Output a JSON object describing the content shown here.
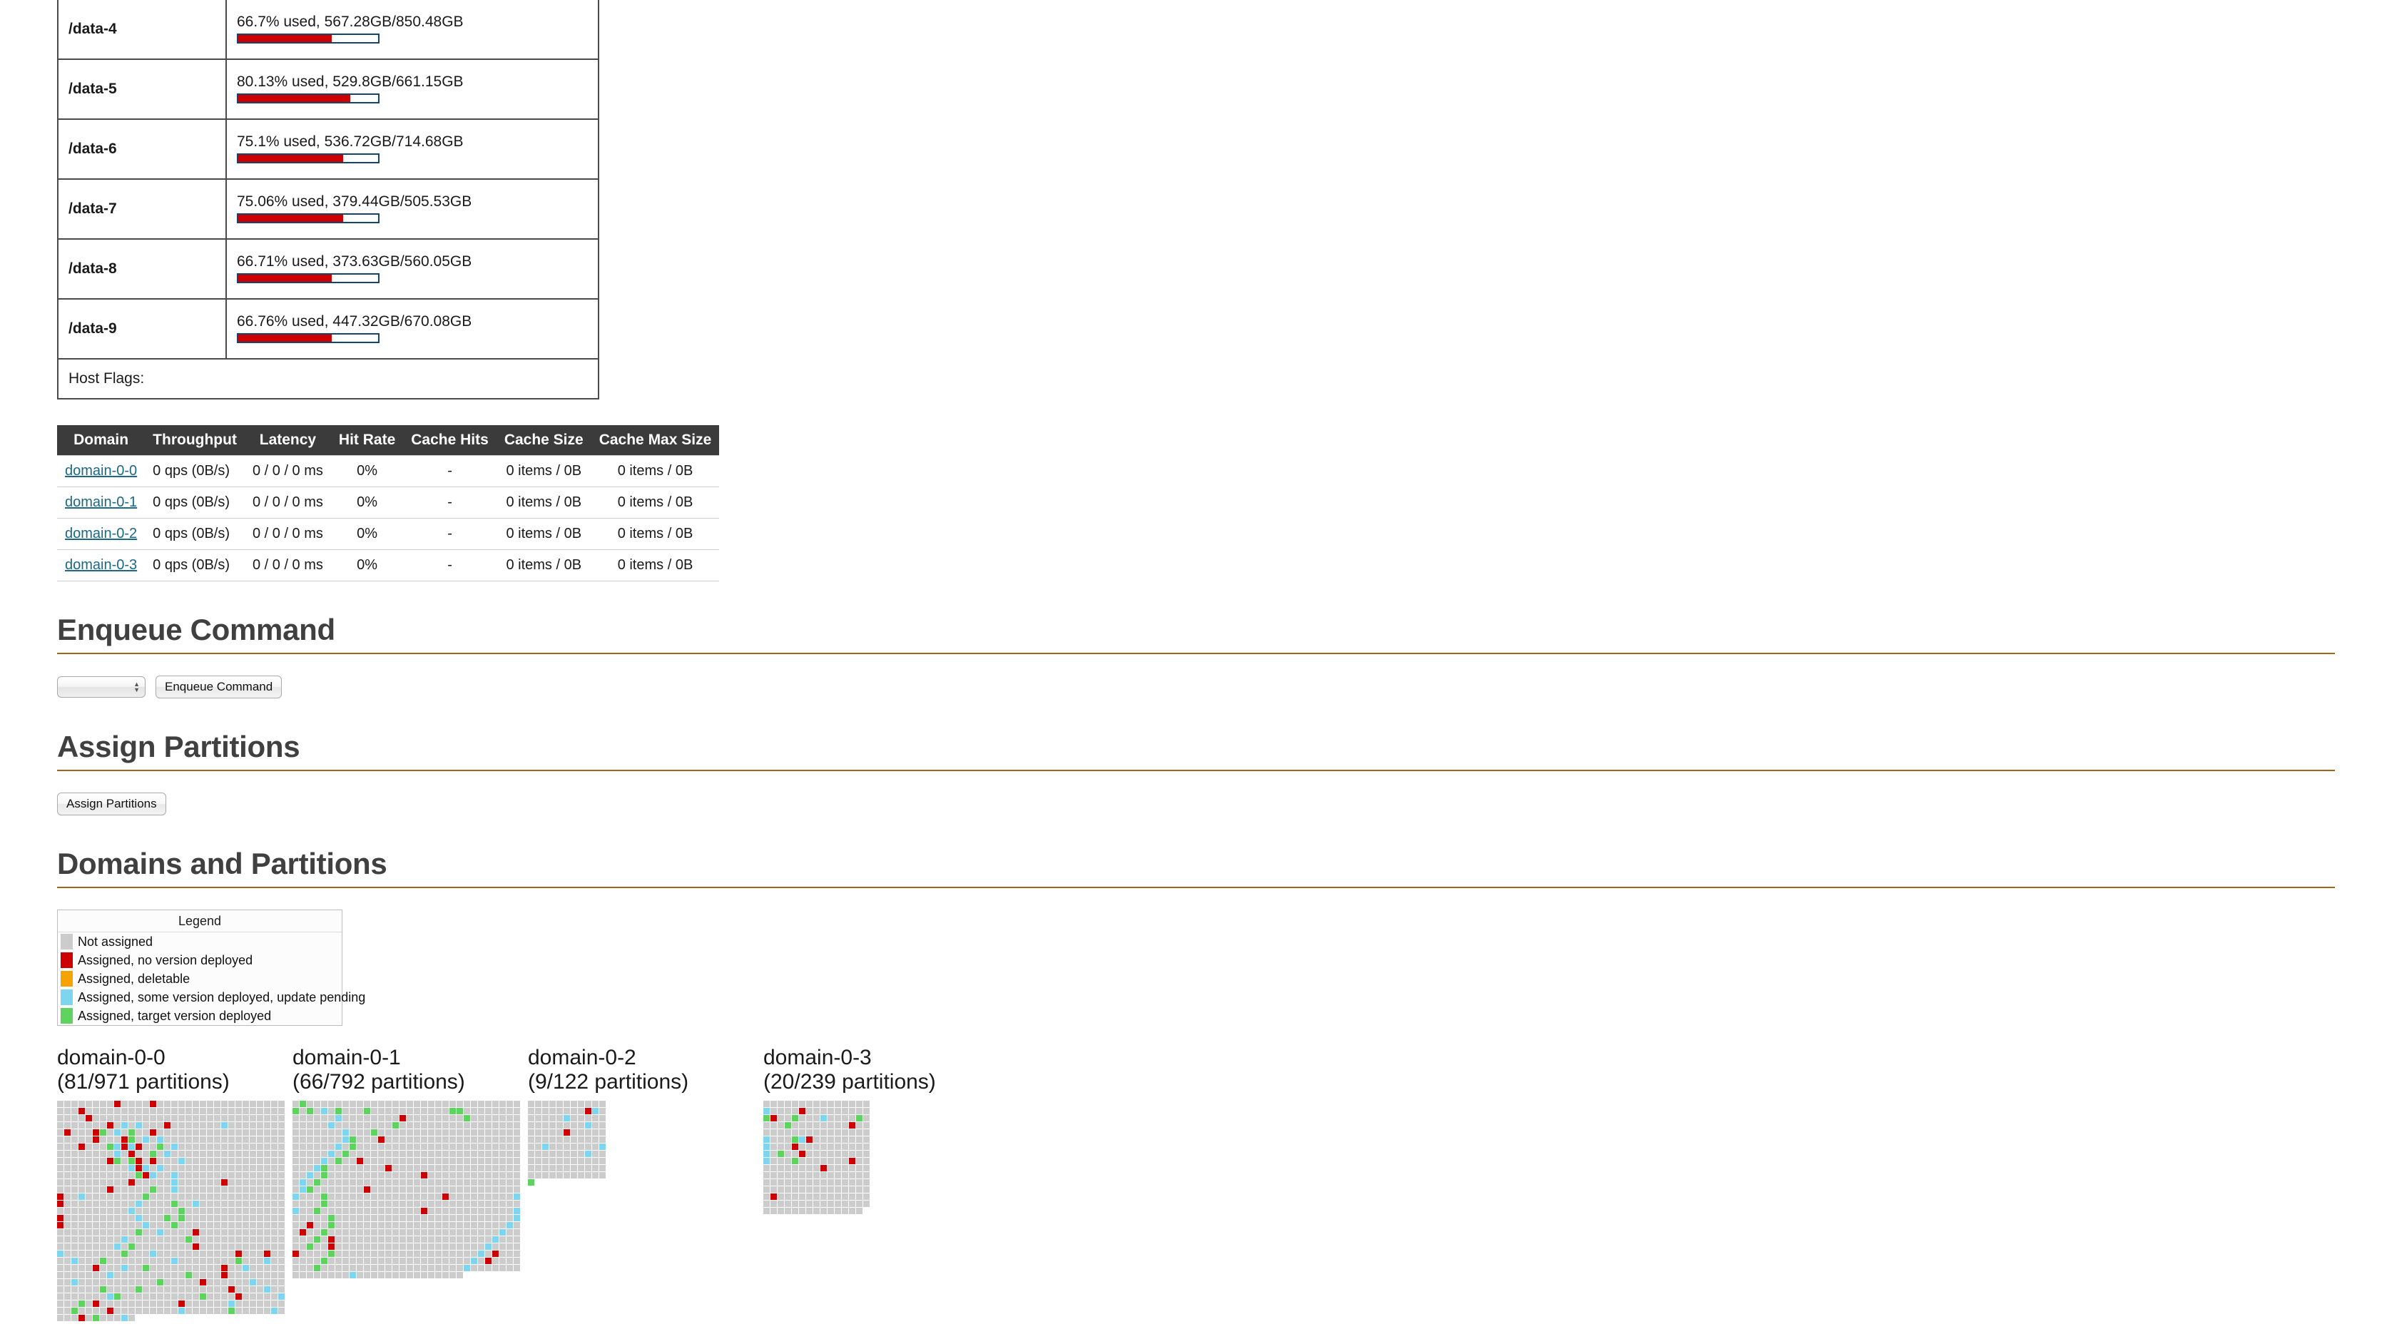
{
  "colors": {
    "accent_rule": "#a0661a",
    "heading": "#404040",
    "table_header_bg": "#3b3b3b",
    "link": "#1a6986",
    "bar_fill": "#cc0000",
    "bar_border": "#16456b",
    "not_assigned": "#cccccc",
    "no_version": "#cc0000",
    "deletable": "#f5a300",
    "update_pending": "#7fd4f0",
    "target_deployed": "#5fd35f"
  },
  "disks": {
    "rows": [
      {
        "name": "/data-4",
        "usage": "66.7% used, 567.28GB/850.48GB",
        "percent": 66.7
      },
      {
        "name": "/data-5",
        "usage": "80.13% used, 529.8GB/661.15GB",
        "percent": 80.13
      },
      {
        "name": "/data-6",
        "usage": "75.1% used, 536.72GB/714.68GB",
        "percent": 75.1
      },
      {
        "name": "/data-7",
        "usage": "75.06% used, 379.44GB/505.53GB",
        "percent": 75.06
      },
      {
        "name": "/data-8",
        "usage": "66.71% used, 373.63GB/560.05GB",
        "percent": 66.71
      },
      {
        "name": "/data-9",
        "usage": "66.76% used, 447.32GB/670.08GB",
        "percent": 66.76
      }
    ],
    "host_flags_label": "Host Flags:"
  },
  "domain_stats": {
    "columns": [
      "Domain",
      "Throughput",
      "Latency",
      "Hit Rate",
      "Cache Hits",
      "Cache Size",
      "Cache Max Size"
    ],
    "rows": [
      {
        "domain": "domain-0-0",
        "throughput": "0 qps (0B/s)",
        "latency": "0 / 0 / 0 ms",
        "hit_rate": "0%",
        "cache_hits": "-",
        "cache_size": "0 items / 0B",
        "cache_max_size": "0 items / 0B"
      },
      {
        "domain": "domain-0-1",
        "throughput": "0 qps (0B/s)",
        "latency": "0 / 0 / 0 ms",
        "hit_rate": "0%",
        "cache_hits": "-",
        "cache_size": "0 items / 0B",
        "cache_max_size": "0 items / 0B"
      },
      {
        "domain": "domain-0-2",
        "throughput": "0 qps (0B/s)",
        "latency": "0 / 0 / 0 ms",
        "hit_rate": "0%",
        "cache_hits": "-",
        "cache_size": "0 items / 0B",
        "cache_max_size": "0 items / 0B"
      },
      {
        "domain": "domain-0-3",
        "throughput": "0 qps (0B/s)",
        "latency": "0 / 0 / 0 ms",
        "hit_rate": "0%",
        "cache_hits": "-",
        "cache_size": "0 items / 0B",
        "cache_max_size": "0 items / 0B"
      }
    ]
  },
  "enqueue_command": {
    "heading": "Enqueue Command",
    "select_value": "",
    "select_options": [
      ""
    ],
    "button_label": "Enqueue Command"
  },
  "assign_partitions": {
    "heading": "Assign Partitions",
    "button_label": "Assign Partitions"
  },
  "domains_and_partitions": {
    "heading": "Domains and Partitions",
    "legend": {
      "title": "Legend",
      "items": [
        {
          "label": "Not assigned",
          "color": "#cccccc"
        },
        {
          "label": "Assigned, no version deployed",
          "color": "#cc0000"
        },
        {
          "label": "Assigned, deletable",
          "color": "#f5a300"
        },
        {
          "label": "Assigned, some version deployed, update pending",
          "color": "#7fd4f0"
        },
        {
          "label": "Assigned, target version deployed",
          "color": "#5fd35f"
        }
      ]
    },
    "domains": [
      {
        "name": "domain-0-0",
        "partitions_label": "(81/971 partitions)",
        "assigned": 81,
        "total": 971,
        "grid_cols": 32,
        "marks": {
          "red": [
            8,
            13,
            35,
            68,
            103,
            111,
            129,
            133,
            141,
            165,
            169,
            195,
            201,
            203,
            234,
            263,
            267,
            269,
            299,
            332,
            362,
            375,
            391,
            416,
            448,
            512,
            544,
            595,
            659,
            697,
            701,
            741,
            759,
            791,
            820,
            856,
            889,
            901,
            913,
            935,
            963
          ],
          "green": [
            134,
            138,
            170,
            199,
            206,
            237,
            264,
            266,
            331,
            397,
            428,
            464,
            497,
            527,
            529,
            560,
            587,
            626,
            650,
            681,
            710,
            729,
            748,
            786,
            814,
            838,
            843,
            872,
            884,
            899,
            930,
            952,
            965
          ],
          "blue": [
            105,
            107,
            119,
            136,
            172,
            174,
            200,
            202,
            208,
            232,
            239,
            273,
            298,
            300,
            302,
            333,
            336,
            368,
            400,
            419,
            459,
            467,
            490,
            523,
            556,
            590,
            617,
            648,
            672,
            685,
            706,
            720,
            733,
            745,
            762,
            775,
            802,
            827,
            861,
            871,
            895,
            920,
            945,
            958,
            969
          ]
        }
      },
      {
        "name": "domain-0-1",
        "partitions_label": "(66/792 partitions)",
        "assigned": 66,
        "total": 792,
        "grid_cols": 32,
        "marks": {
          "red": [
            79,
            172,
            265,
            301,
            338,
            394,
            437,
            498,
            546,
            577,
            613,
            645,
            672,
            700,
            731
          ],
          "green": [
            1,
            32,
            34,
            38,
            42,
            54,
            55,
            88,
            110,
            139,
            168,
            200,
            231,
            262,
            292,
            324,
            355,
            386,
            420,
            452,
            483,
            517,
            549,
            580,
            611,
            642,
            677,
            708,
            739
          ],
          "blue": [
            36,
            70,
            101,
            135,
            167,
            198,
            229,
            260,
            291,
            322,
            353,
            385,
            416,
            447,
            480,
            511,
            543,
            574,
            605,
            636,
            667,
            698,
            729,
            760,
            776
          ]
        }
      },
      {
        "name": "domain-0-2",
        "partitions_label": "(9/122 partitions)",
        "assigned": 9,
        "total": 122,
        "grid_cols": 11,
        "marks": {
          "red": [
            19,
            49
          ],
          "green": [
            121
          ],
          "blue": [
            20,
            27,
            41,
            68,
            76,
            85
          ]
        }
      },
      {
        "name": "domain-0-3",
        "partitions_label": "(20/239 partitions)",
        "assigned": 20,
        "total": 239,
        "grid_cols": 15,
        "marks": {
          "red": [
            20,
            31,
            57,
            81,
            94,
            110,
            132,
            143,
            196
          ],
          "green": [
            30,
            34,
            43,
            48,
            79,
            107,
            124
          ],
          "blue": [
            15,
            38,
            75,
            80,
            90,
            105,
            120
          ]
        }
      }
    ]
  }
}
